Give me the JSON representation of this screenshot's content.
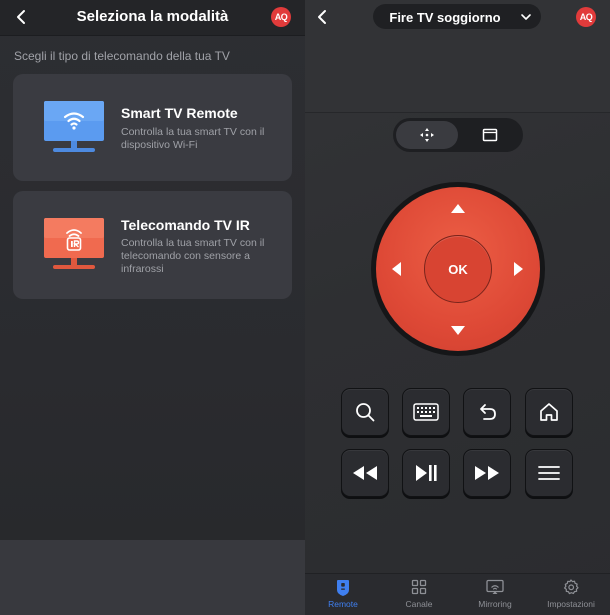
{
  "left": {
    "header": {
      "title": "Seleziona la modalità",
      "brand": "AQ"
    },
    "subtitle": "Scegli il tipo di telecomando della tua TV",
    "cards": [
      {
        "title": "Smart TV Remote",
        "description": "Controlla la tua smart TV con il dispositivo Wi-Fi",
        "icon": "wifi-tv-icon",
        "color": "#5b9bf0"
      },
      {
        "title": "Telecomando TV IR",
        "description": "Controlla la tua smart TV con il telecomando con sensore a infrarossi",
        "icon": "ir-tv-icon",
        "color": "#f06a4f"
      }
    ]
  },
  "right": {
    "header": {
      "device": "Fire TV soggiorno",
      "brand": "AQ"
    },
    "dpad": {
      "ok_label": "OK",
      "color": "#e24d38"
    },
    "tabs": [
      {
        "label": "Remote",
        "icon": "remote-icon",
        "active": true
      },
      {
        "label": "Canale",
        "icon": "grid-icon",
        "active": false
      },
      {
        "label": "Mirroring",
        "icon": "cast-icon",
        "active": false
      },
      {
        "label": "Impostazioni",
        "icon": "gear-icon",
        "active": false
      }
    ]
  },
  "colors": {
    "accent": "#3f7ff0",
    "brand": "#e13b3b"
  }
}
